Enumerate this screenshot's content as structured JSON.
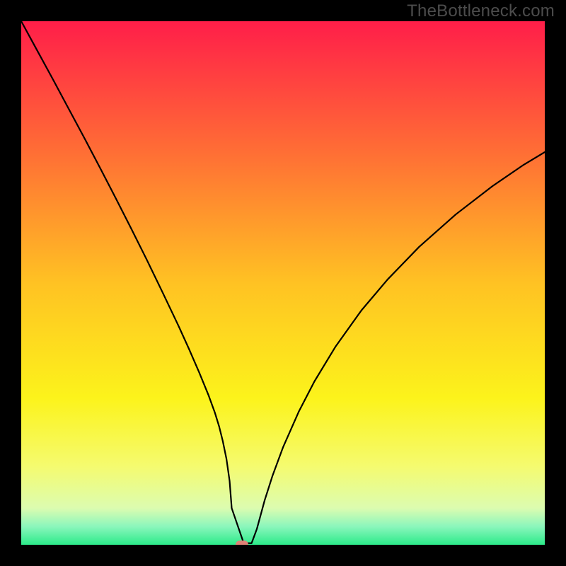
{
  "watermark": "TheBottleneck.com",
  "chart_data": {
    "type": "line",
    "title": "",
    "xlabel": "",
    "ylabel": "",
    "xlim": [
      0,
      100
    ],
    "ylim": [
      0,
      100
    ],
    "grid": false,
    "legend": false,
    "gradient_stops": [
      {
        "offset": 0,
        "color": "#ff1e49"
      },
      {
        "offset": 0.25,
        "color": "#ff6e35"
      },
      {
        "offset": 0.5,
        "color": "#ffc223"
      },
      {
        "offset": 0.72,
        "color": "#fcf31b"
      },
      {
        "offset": 0.85,
        "color": "#f5fb6f"
      },
      {
        "offset": 0.93,
        "color": "#dcfcb0"
      },
      {
        "offset": 0.965,
        "color": "#8bf6bc"
      },
      {
        "offset": 1.0,
        "color": "#2ceb8a"
      }
    ],
    "series": [
      {
        "name": "bottleneck-curve",
        "x": [
          0,
          3,
          6,
          9,
          12,
          15,
          18,
          21,
          24,
          27,
          30,
          32,
          34,
          35.8,
          37,
          37.8,
          38.5,
          39.2,
          39.8,
          40.2,
          42.5,
          43.2,
          44,
          45,
          46.5,
          48,
          50,
          53,
          56,
          60,
          65,
          70,
          76,
          83,
          90,
          96,
          100
        ],
        "y": [
          100,
          94.5,
          89,
          83.4,
          77.8,
          72.1,
          66.3,
          60.4,
          54.4,
          48.2,
          41.9,
          37.5,
          32.9,
          28.5,
          25.2,
          22.6,
          19.8,
          16.4,
          12.2,
          7.0,
          0.3,
          0.3,
          0.3,
          3.0,
          8.5,
          13.2,
          18.6,
          25.4,
          31.2,
          37.8,
          44.8,
          50.7,
          56.9,
          63.1,
          68.5,
          72.6,
          75.0
        ]
      }
    ],
    "marker": {
      "x": 42.2,
      "y": 0.0,
      "color": "#df8277"
    }
  }
}
